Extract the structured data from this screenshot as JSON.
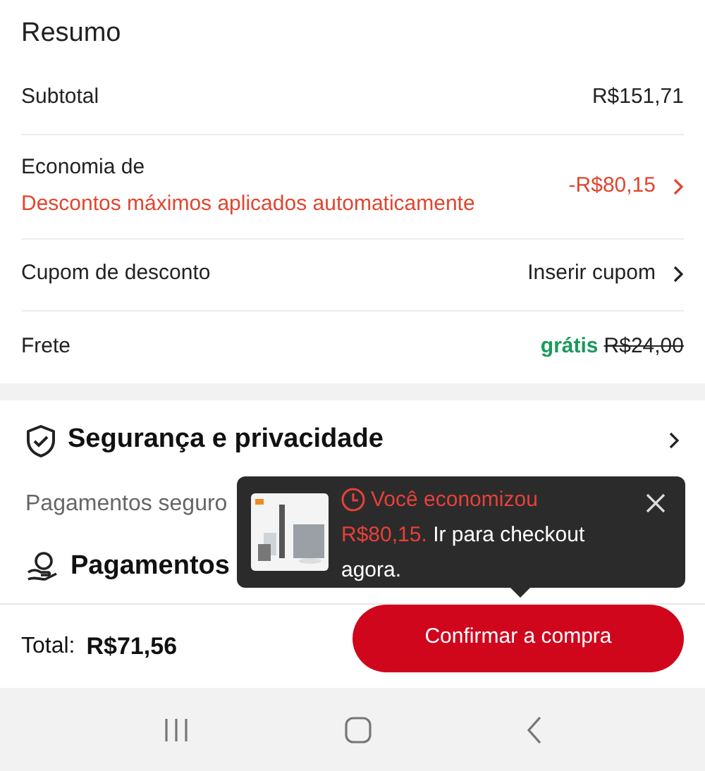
{
  "summary": {
    "title": "Resumo",
    "rows": [
      {
        "kind": "plain",
        "label": "Subtotal",
        "value": "R$151,71"
      },
      {
        "kind": "discount",
        "label": "Economia de",
        "note": "Descontos máximos aplicados automaticamente",
        "value": "-R$80,15"
      },
      {
        "kind": "link",
        "label": "Cupom de desconto",
        "value": "Inserir cupom"
      },
      {
        "kind": "shipping",
        "label": "Frete",
        "value": "grátis",
        "old_value": "R$24,00"
      }
    ]
  },
  "security": {
    "title": "Segurança e privacidade",
    "subtitle": "Pagamentos seguro",
    "section_title": "Pagamentos"
  },
  "toast": {
    "highlight": "Você economizou R$80,15.",
    "text": "Ir para checkout agora."
  },
  "footer": {
    "total_label": "Total:",
    "total_value": "R$71,56",
    "button": "Confirmar a compra"
  }
}
